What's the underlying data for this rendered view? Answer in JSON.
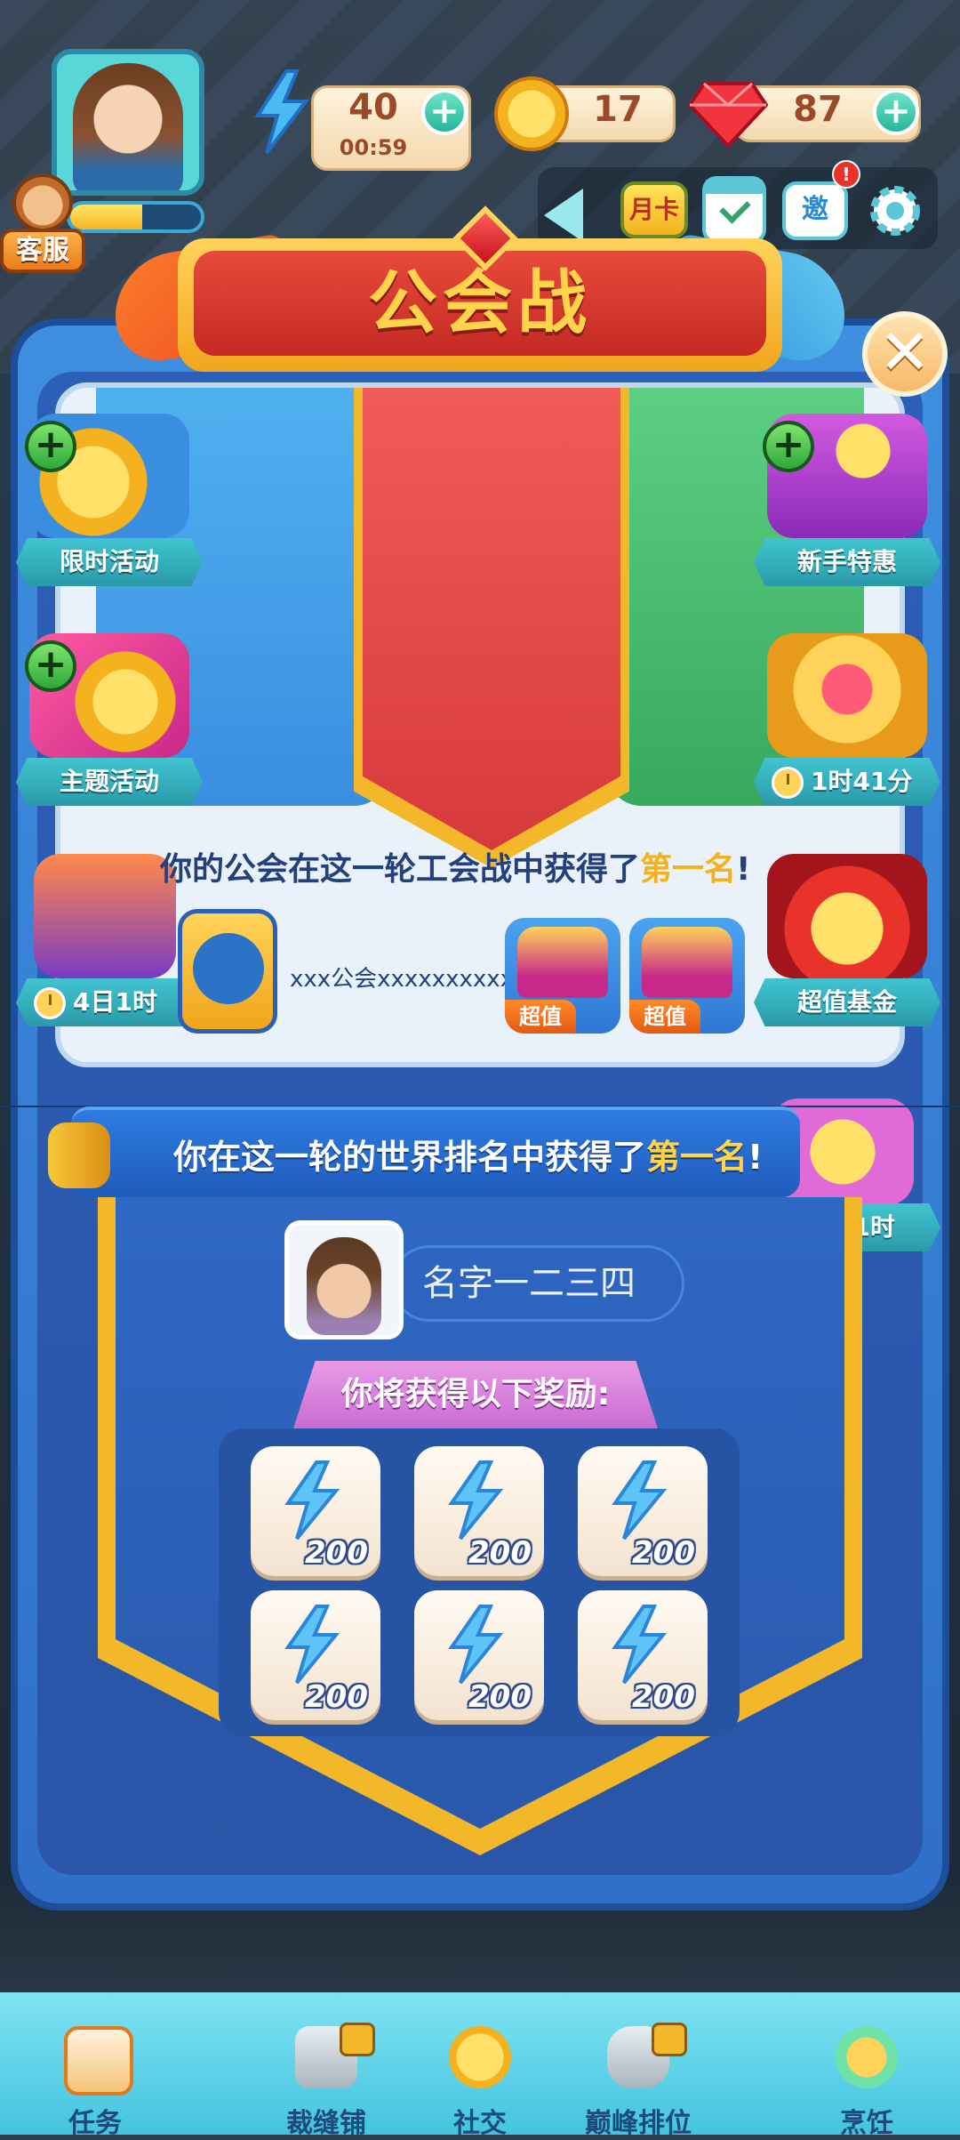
{
  "hud": {
    "energy_value": "40",
    "energy_timer": "00:59",
    "coins_value": "17",
    "gems_value": "87",
    "customer_service_label": "客服",
    "xp_progress": 0.55
  },
  "iconbar": {
    "month_card_label": "月卡",
    "invite_label": "邀"
  },
  "title": "公会战",
  "activities_left": [
    {
      "label": "限时活动"
    },
    {
      "label": "主题活动"
    },
    {
      "timer": "4日1时"
    }
  ],
  "activities_right": [
    {
      "label": "新手特惠"
    },
    {
      "timer": "1时41分"
    },
    {
      "label": "超值基金"
    },
    {
      "timer": "1日1时"
    }
  ],
  "guild_result": {
    "message_prefix": "你的公会在这一轮工会战中获得了",
    "message_highlight": "第一名",
    "message_suffix": "!",
    "guild_name": "xxx公会xxxxxxxxxx",
    "chests": [
      {
        "tag": "超值"
      },
      {
        "tag": "超值"
      }
    ]
  },
  "world_rank": {
    "message_prefix": "你在这一轮的世界排名中获得了",
    "message_highlight": "第一名",
    "message_suffix": "!",
    "player_name": "名字一二三四",
    "reward_title": "你将获得以下奖励:",
    "rewards": [
      "200",
      "200",
      "200",
      "200",
      "200",
      "200"
    ]
  },
  "bottom_nav": [
    {
      "label": "任务",
      "locked": false
    },
    {
      "label": "裁缝铺",
      "locked": true
    },
    {
      "label": "社交",
      "locked": false
    },
    {
      "label": "巅峰排位",
      "locked": true
    },
    {
      "label": "烹饪",
      "locked": false
    }
  ],
  "colors": {
    "panel_blue": "#2f6fc9",
    "title_red": "#c42a23",
    "title_gold": "#ffd44a",
    "highlight_yellow": "#f3b21c",
    "nav_cyan": "#44c4df"
  }
}
